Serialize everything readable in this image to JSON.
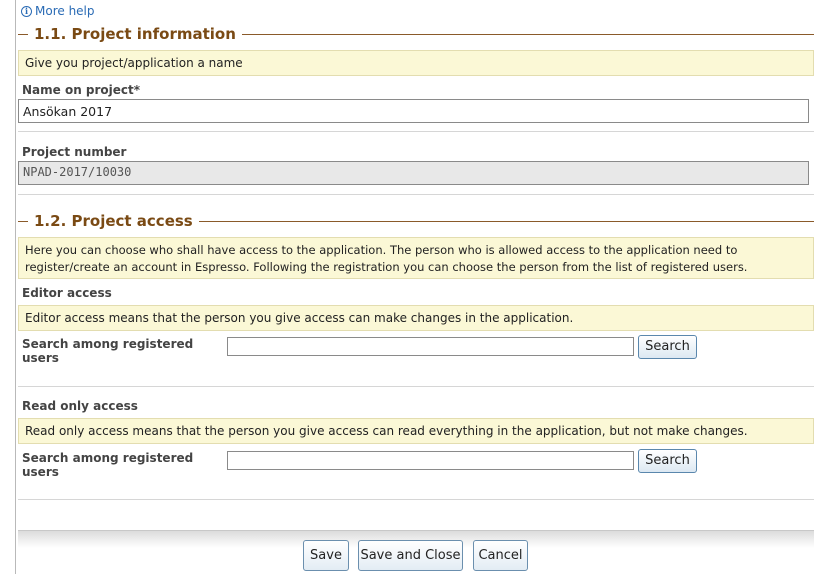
{
  "help": {
    "label": "More help"
  },
  "section1": {
    "title": "1.1. Project information",
    "info": "Give you project/application a name",
    "name_label": "Name on project*",
    "name_value": "Ansökan 2017",
    "number_label": "Project number",
    "number_value": "NPAD-2017/10030"
  },
  "section2": {
    "title": "1.2. Project access",
    "info": "Here you can choose who shall have access to the application. The person who is allowed access to the application need to register/create an account in Espresso. Following the registration you can choose the person from the list of registered users.",
    "editor": {
      "label": "Editor access",
      "info": "Editor access means that the person you give access can make changes in the application.",
      "search_label": "Search among registered users",
      "search_button": "Search"
    },
    "readonly": {
      "label": "Read only access",
      "info": "Read only access means that the person you give access can read everything in the application, but not make changes.",
      "search_label": "Search among registered users",
      "search_button": "Search"
    }
  },
  "footer": {
    "save": "Save",
    "save_close": "Save and Close",
    "cancel": "Cancel"
  }
}
